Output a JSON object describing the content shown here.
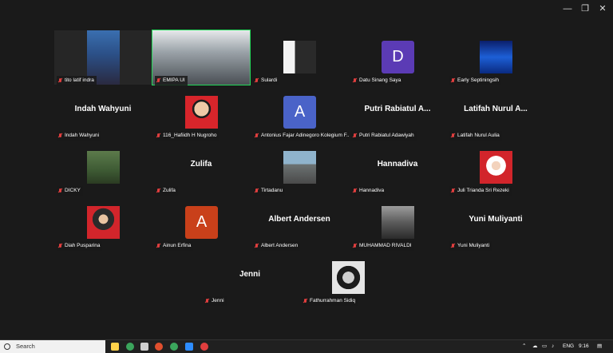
{
  "window": {
    "minimize": "—",
    "restore": "❐",
    "close": "✕"
  },
  "participants": [
    {
      "label": "tito latif indra",
      "type": "photo",
      "photo": "man-glasses"
    },
    {
      "label": "EMIPA UI",
      "type": "photo",
      "photo": "room",
      "active": true
    },
    {
      "label": "Sulardi",
      "type": "photo",
      "photo": "man-suit"
    },
    {
      "label": "Datu Sinang Saya",
      "type": "avatar",
      "initial": "D",
      "color": "#5b3bb5"
    },
    {
      "label": "Early Septiningsih",
      "type": "photo",
      "photo": "blue-abstract"
    },
    {
      "label": "Indah Wahyuni",
      "type": "name",
      "display": "Indah Wahyuni"
    },
    {
      "label": "116_Hafiidh H Nugroho",
      "type": "photo",
      "photo": "boy-red"
    },
    {
      "label": "Antonius Fajar Adinegoro Kolegium F...",
      "type": "avatar",
      "initial": "A",
      "color": "#4a63c8"
    },
    {
      "label": "Putri Rabiatul Adawiyah",
      "type": "name",
      "display": "Putri Rabiatul A..."
    },
    {
      "label": "Latifah Nurul Aulia",
      "type": "name",
      "display": "Latifah Nurul A..."
    },
    {
      "label": "DICKY",
      "type": "photo",
      "photo": "forest"
    },
    {
      "label": "Zulifa",
      "type": "name",
      "display": "Zulifa"
    },
    {
      "label": "Tirtadanu",
      "type": "photo",
      "photo": "street"
    },
    {
      "label": "Hannadiva",
      "type": "name",
      "display": "Hannadiva"
    },
    {
      "label": "Juli Trianda Sri Rezeki",
      "type": "photo",
      "photo": "hijab-red"
    },
    {
      "label": "Diah Pusparina",
      "type": "photo",
      "photo": "hijab-red-2"
    },
    {
      "label": "Ainun Erfina",
      "type": "avatar",
      "initial": "A",
      "color": "#c9401a"
    },
    {
      "label": "Albert Andersen",
      "type": "name",
      "display": "Albert Andersen"
    },
    {
      "label": "MUHAMMAD RIVALDI",
      "type": "photo",
      "photo": "bw-person"
    },
    {
      "label": "Yuni Muliyanti",
      "type": "name",
      "display": "Yuni Muliyanti"
    },
    {
      "label": "Jenni",
      "type": "name",
      "display": "Jenni"
    },
    {
      "label": "Fathurrahman Sidiq",
      "type": "photo",
      "photo": "bw-face"
    }
  ],
  "taskbar": {
    "search_label": "Search",
    "language": "ENG",
    "time": "9:16"
  }
}
